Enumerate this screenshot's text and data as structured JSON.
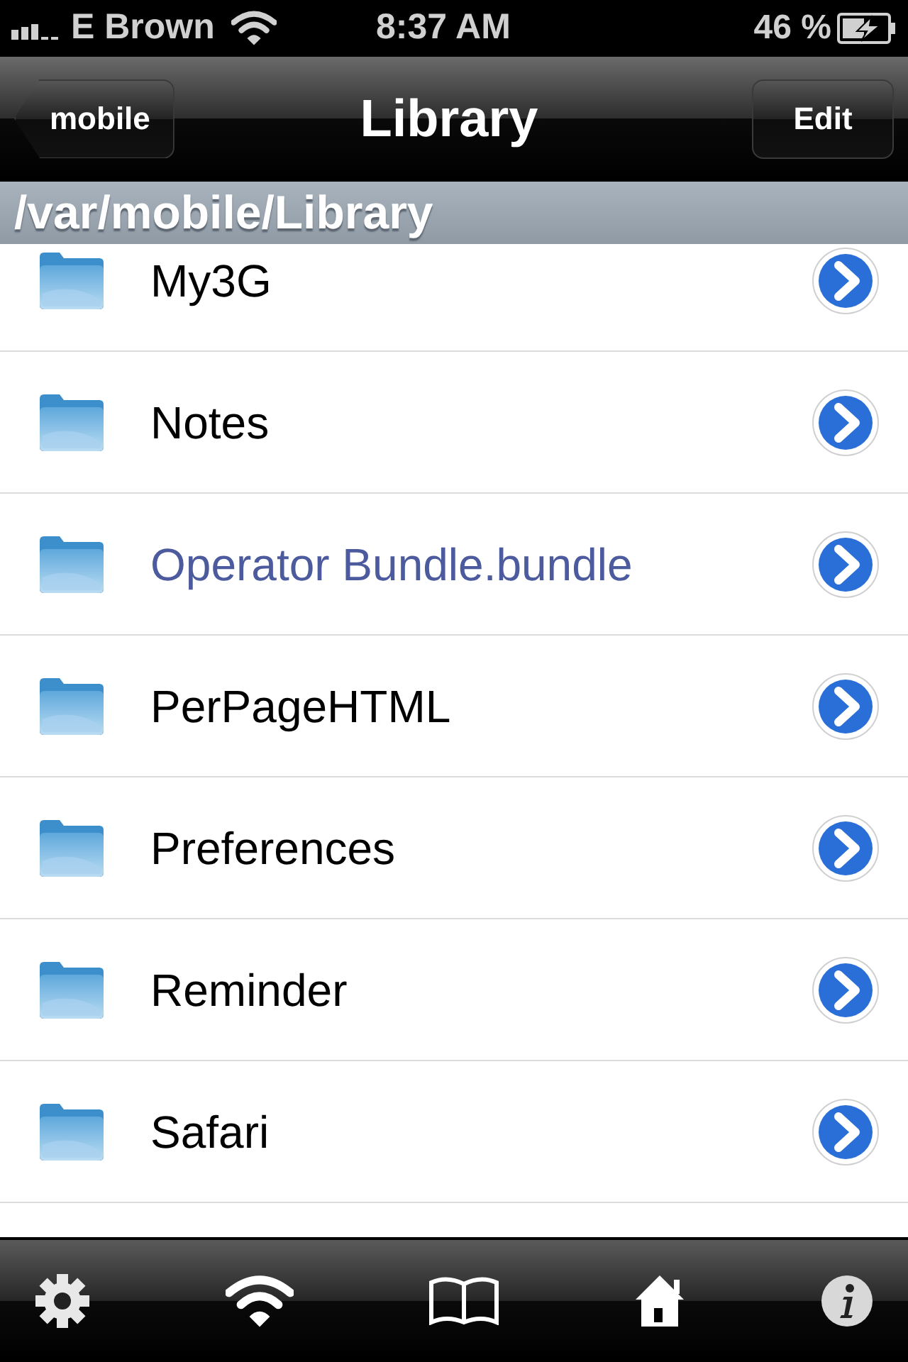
{
  "status_bar": {
    "carrier": "E Brown",
    "time": "8:37 AM",
    "battery": "46 %"
  },
  "nav_bar": {
    "back": "mobile",
    "title": "Library",
    "edit": "Edit"
  },
  "path": "/var/mobile/Library",
  "rows": [
    {
      "name": "My3G",
      "kind": "folder"
    },
    {
      "name": "Notes",
      "kind": "folder"
    },
    {
      "name": "Operator Bundle.bundle",
      "kind": "bundle"
    },
    {
      "name": "PerPageHTML",
      "kind": "folder"
    },
    {
      "name": "Preferences",
      "kind": "folder"
    },
    {
      "name": "Reminder",
      "kind": "folder"
    },
    {
      "name": "Safari",
      "kind": "folder"
    }
  ]
}
